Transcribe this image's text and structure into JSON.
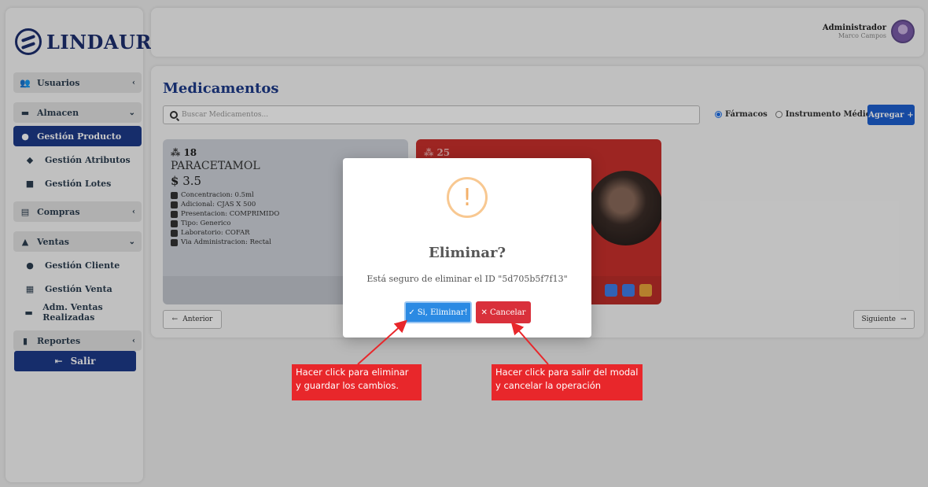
{
  "brand": {
    "name": "LINDAURA"
  },
  "sidebar": {
    "items": [
      {
        "label": "Usuarios",
        "icon": "users-icon",
        "chevron": "‹"
      },
      {
        "label": "Almacen",
        "icon": "box-icon",
        "chevron": "⌄"
      },
      {
        "label": "Gestión Producto",
        "icon": "pills-icon"
      },
      {
        "label": "Gestión Atributos",
        "icon": "tags-icon"
      },
      {
        "label": "Gestión Lotes",
        "icon": "cubes-icon"
      },
      {
        "label": "Compras",
        "icon": "cart-icon",
        "chevron": "‹"
      },
      {
        "label": "Ventas",
        "icon": "cash-icon",
        "chevron": "⌄"
      },
      {
        "label": "Gestión Cliente",
        "icon": "user-icon"
      },
      {
        "label": "Gestión Venta",
        "icon": "register-icon"
      },
      {
        "label": "Adm. Ventas Realizadas",
        "icon": "money-icon"
      },
      {
        "label": "Reportes",
        "icon": "report-icon",
        "chevron": "‹"
      }
    ],
    "logout_label": "Salir"
  },
  "header": {
    "user_role": "Administrador",
    "user_name": "Marco Campos"
  },
  "main": {
    "title": "Medicamentos",
    "search_placeholder": "Buscar Medicamentos...",
    "radio_farmacos": "Fármacos",
    "radio_instrumentos": "Instrumento Médicos",
    "add_label": "Agregar",
    "prev_label": "Anterior",
    "next_label": "Siguiente"
  },
  "cards": [
    {
      "id": "18",
      "name": "PARACETAMOL",
      "price": "3.5",
      "props": [
        "Concentracion: 0.5ml",
        "Adicional: CJAS X 500",
        "Presentacion: COMPRIMIDO",
        "Tipo: Generico",
        "Laboratorio: COFAR",
        "Via Administracion: Rectal"
      ]
    },
    {
      "id": "25"
    }
  ],
  "modal": {
    "icon": "!",
    "title": "Eliminar?",
    "text": "Está seguro de eliminar el ID \"5d705b5f7f13\"",
    "confirm_label": "Si, Eliminar!",
    "cancel_label": "Cancelar"
  },
  "annotations": {
    "confirm_note_line1": "Hacer click para eliminar",
    "confirm_note_line2": "y guardar los cambios.",
    "cancel_note_line1": "Hacer click para salir del modal",
    "cancel_note_line2": "y cancelar la operación"
  },
  "colors": {
    "brand": "#1d3a8a",
    "confirm": "#2b8ae3",
    "cancel": "#d9303b",
    "annotation": "#e8272b",
    "warning": "#f3b06a"
  }
}
